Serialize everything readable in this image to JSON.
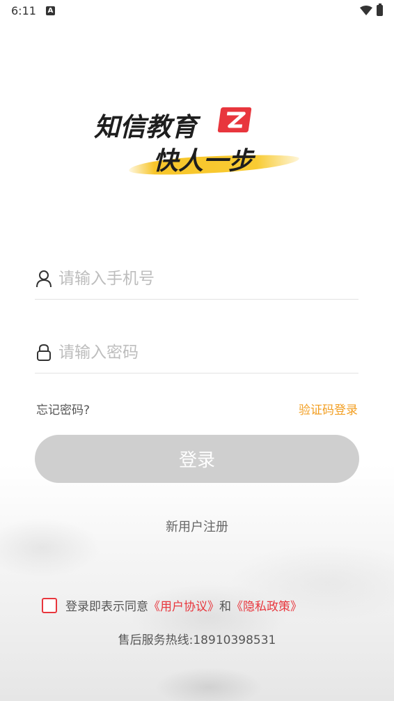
{
  "status_bar": {
    "time": "6:11",
    "a_badge": "A"
  },
  "logo": {
    "line1": "知信教育",
    "line2": "快人一步",
    "accent_color": "#e8363d",
    "brush_color": "#f7c52a"
  },
  "form": {
    "phone_placeholder": "请输入手机号",
    "password_placeholder": "请输入密码",
    "forgot_password": "忘记密码?",
    "sms_login": "验证码登录",
    "login_button": "登录",
    "register": "新用户注册"
  },
  "agreement": {
    "prefix": "登录即表示同意",
    "user_agreement": "《用户协议》",
    "and": "和",
    "privacy_policy": "《隐私政策》",
    "checked": false
  },
  "hotline": "售后服务热线:18910398531",
  "colors": {
    "accent_orange": "#f29e21",
    "accent_red": "#e8363d",
    "button_disabled": "#cfcfcf"
  }
}
